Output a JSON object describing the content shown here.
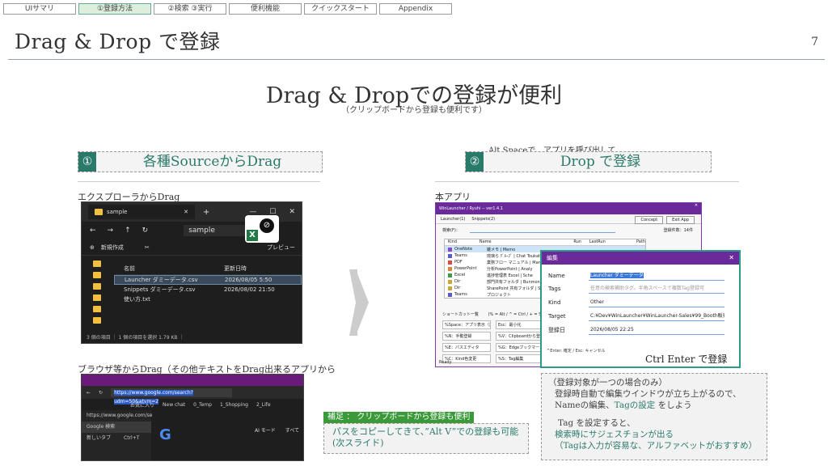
{
  "nav": [
    "UIサマリ",
    "①登録方法",
    "②検索 ③実行",
    "便利機能",
    "クイックスタート",
    "Appendix"
  ],
  "slide": {
    "title": "Drag & Drop で登録",
    "page_number": "7",
    "heading": "Drag & Dropでの登録が便利",
    "subheading": "（クリップボードから登録も便利です）"
  },
  "step1": {
    "number": "①",
    "label": "各種SourceからDrag"
  },
  "step2": {
    "number": "②",
    "label": "Drop で登録",
    "note": "Alt Spaceで、アプリを呼び出して"
  },
  "captions": {
    "explorer": "エクスプローラからDrag",
    "app": "本アプリ",
    "browser": "ブラウザ等からDrag（その他テキストをDrag出来るアプリから"
  },
  "explorer": {
    "tab": "sample",
    "path": "sample",
    "new_button": "新規作成",
    "preview": "プレビュー",
    "col_name": "名前",
    "col_date": "更新日時",
    "files": [
      {
        "name": "Launcher ダミーデータ.csv",
        "date": "2026/08/05 5:50",
        "selected": true
      },
      {
        "name": "Snippets ダミーデータ.csv",
        "date": "2026/08/02 21:50",
        "selected": false
      },
      {
        "name": "使い方.txt",
        "date": "2026/08/02 21:50",
        "selected": false
      }
    ],
    "status": "3 個の項目 ｜ 1 個の項目を選択 1.79 KB ｜",
    "excel_letter": "X",
    "drag_glyph": "⊘"
  },
  "app": {
    "title": "WinLauncher / Ryuhi -- ver1.4.1",
    "tabs": [
      "Launcher(1)",
      "Snippets(2)"
    ],
    "buttons": [
      "Concept",
      "Exit App"
    ],
    "search_label": "検索(F)：",
    "reg_count": "登録件数：14件",
    "columns": [
      "Kind",
      "Name",
      "Run",
      "LastRun",
      "Path"
    ],
    "rows": [
      {
        "kind": "OneNote",
        "name": "雑メモ | Memo",
        "color": "#8a4ac8"
      },
      {
        "kind": "Teams",
        "name": "琉璃ら ｸﾞﾙｰﾌﾟ | Chat Toukatsu",
        "color": "#5a5ac8"
      },
      {
        "kind": "PDF",
        "name": "業務フロー マニュアル | Manual",
        "color": "#d84a4a"
      },
      {
        "kind": "PowerPoint",
        "name": "分析PowerPoint | Analy",
        "color": "#d8843a"
      },
      {
        "kind": "Excel",
        "name": "進捗管理表 Excel | Sche",
        "color": "#3a9a4a"
      },
      {
        "kind": "Dir",
        "name": "部門共有フォルダ | Bunmon",
        "color": "#c8a83a"
      },
      {
        "kind": "Dir",
        "name": "SharePoint 共有フォルダ | Shapo",
        "color": "#c8a83a"
      },
      {
        "kind": "Teams",
        "name": "プロジェクト",
        "color": "#5a5ac8"
      }
    ],
    "shortcut_label": "ショートカット一覧",
    "shortcut_hint": "(% = Alt / ^ = Ctrl / + = Shift)",
    "shortcuts": [
      "%Space：アプリ表示（遅灯：F7移動）",
      "Esc：最小化",
      "Enter",
      "%N：手動登録",
      "%V：Clipboardから登録",
      "Del",
      "%E：パスエディタ",
      "%G：Edgeブックマーク",
      "%D",
      "%C：Kind色変更",
      "%S：Tag編集",
      "%F：出力簿登録"
    ],
    "status": "Ready"
  },
  "dialog": {
    "title": "編集",
    "fields": [
      {
        "label": "Name",
        "value": "Launcher ダミーデータ",
        "style": "highlight"
      },
      {
        "label": "Tags",
        "value": "任意の検索補助タグ。半角スペースで複数Tag登録可",
        "style": "placeholder"
      },
      {
        "label": "Kind",
        "value": "Other",
        "style": "normal"
      },
      {
        "label": "Target",
        "value": "C:¥Dev¥WinLauncher¥WinLauncher-Sales¥99_Booth販売",
        "style": "normal"
      },
      {
        "label": "登録日",
        "value": "2026/08/05 22:25",
        "style": "normal"
      }
    ],
    "hint": "^Enter: 確定 / Esc: キャンセル"
  },
  "ctrl_enter": "Ctrl Enter で登録",
  "callout": {
    "line1": "（登録対象が一つの場合のみ）",
    "line2": "登録時自動で編集ウインドウが立ち上がるので、",
    "line3_pre": "Nameの編集、",
    "line3_accent": "Tagの設定",
    "line3_post": " をしよう",
    "line4": "Tag を設定すると、",
    "line5": "検索時にサジェスチョンが出る",
    "line6": "（Tagは入力が容易な、アルファベットがおすすめ）"
  },
  "browser": {
    "url": "https://www.google.com/search?udm=50&atvm=2",
    "bookmarks": [
      "お気に入り",
      "New chat",
      "0_Temp",
      "1_Shopping",
      "2_Life"
    ],
    "side_url": "https://www.google.com/se",
    "side_tab": "Google 検索",
    "new_tab": "新しいタブ",
    "new_tab_key": "Ctrl+T",
    "logo": "G",
    "ai_mode": "AI モード　　すべて"
  },
  "supplement": {
    "label": "補足 ： クリップボードから登録も便利",
    "line1": "パスをコピーしてきて、”Alt V”での登録も可能",
    "line2": "(次スライド)"
  }
}
